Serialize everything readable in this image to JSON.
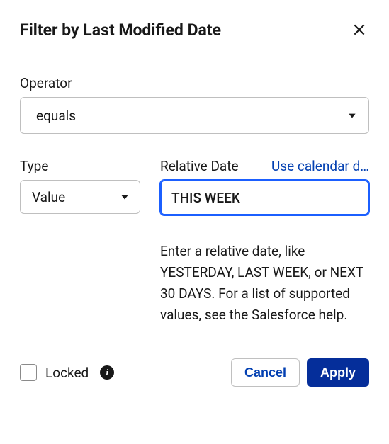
{
  "header": {
    "title": "Filter by Last Modified Date"
  },
  "operator": {
    "label": "Operator",
    "value": "equals"
  },
  "type": {
    "label": "Type",
    "value": "Value"
  },
  "relative": {
    "label": "Relative Date",
    "link_text": "Use calendar d…",
    "input_value": "THIS WEEK",
    "help_text": "Enter a relative date, like YESTERDAY, LAST WEEK, or NEXT 30 DAYS. For a list of supported values, see the Salesforce help."
  },
  "locked": {
    "label": "Locked",
    "checked": false
  },
  "buttons": {
    "cancel": "Cancel",
    "apply": "Apply"
  }
}
